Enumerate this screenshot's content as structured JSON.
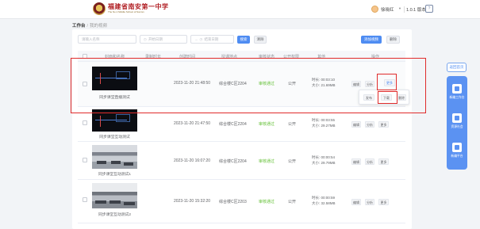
{
  "header": {
    "logo_cn": "福建省南安第一中学",
    "logo_en": "The No.1 Middle School of Nan'an",
    "user_name": "徐晓红",
    "version": "1.0.1 版本",
    "help_icon": "help-icon"
  },
  "breadcrumb": {
    "root": "工作台",
    "separator": "/",
    "current": "我的视频"
  },
  "search": {
    "name_placeholder": "请输入名称",
    "start_placeholder": "开始日期",
    "end_placeholder": "结束日期",
    "search_label": "搜索",
    "clear_label": "清除",
    "add_label": "添加视频",
    "delete_label": "删除"
  },
  "table": {
    "columns": [
      "封面和名称",
      "录制时长",
      "创建时间",
      "授课地点",
      "审核状态",
      "公开权限",
      "其他",
      "操作"
    ],
    "rows": [
      {
        "title": "同步课堂直播测试",
        "created": "2023-11-20 21:48:50",
        "location": "综合楼C区2204",
        "status": "审核通过",
        "permission": "公开",
        "duration": "时长: 00:03:10",
        "size": "大小: 21.69MB",
        "ops": [
          "编辑",
          "分析",
          "更多"
        ]
      },
      {
        "title": "同步课堂互动测试",
        "created": "2023-11-20 21:47:50",
        "location": "综合楼C区2204",
        "status": "审核通过",
        "permission": "公开",
        "duration": "时长: 00:03:55",
        "size": "大小: 29.27MB",
        "ops": [
          "编辑",
          "分析",
          "更多"
        ]
      },
      {
        "title": "同步课堂互动测试1",
        "created": "2023-11-20 16:07:20",
        "location": "综合楼C区2204",
        "status": "审核通过",
        "permission": "公开",
        "duration": "时长: 00:00:54",
        "size": "大小: 29.79MB",
        "ops": [
          "编辑",
          "分析",
          "更多"
        ]
      },
      {
        "title": "同步课堂互动测试2",
        "created": "2023-11-20 15:32:20",
        "location": "综合楼C区2203",
        "status": "审核通过",
        "permission": "公开",
        "duration": "时长: 00:00:59",
        "size": "大小: 32.58MB",
        "ops": [
          "编辑",
          "分析",
          "更多"
        ]
      }
    ]
  },
  "popup": {
    "items": [
      "发布",
      "下载",
      "删除"
    ]
  },
  "side_float": {
    "top_label": "返回首页",
    "items": [
      "新编工作台",
      "资源社会",
      "新编平台"
    ]
  },
  "colors": {
    "primary": "#4e8cf2",
    "success": "#67c23a",
    "annotation": "#e02b2b"
  }
}
